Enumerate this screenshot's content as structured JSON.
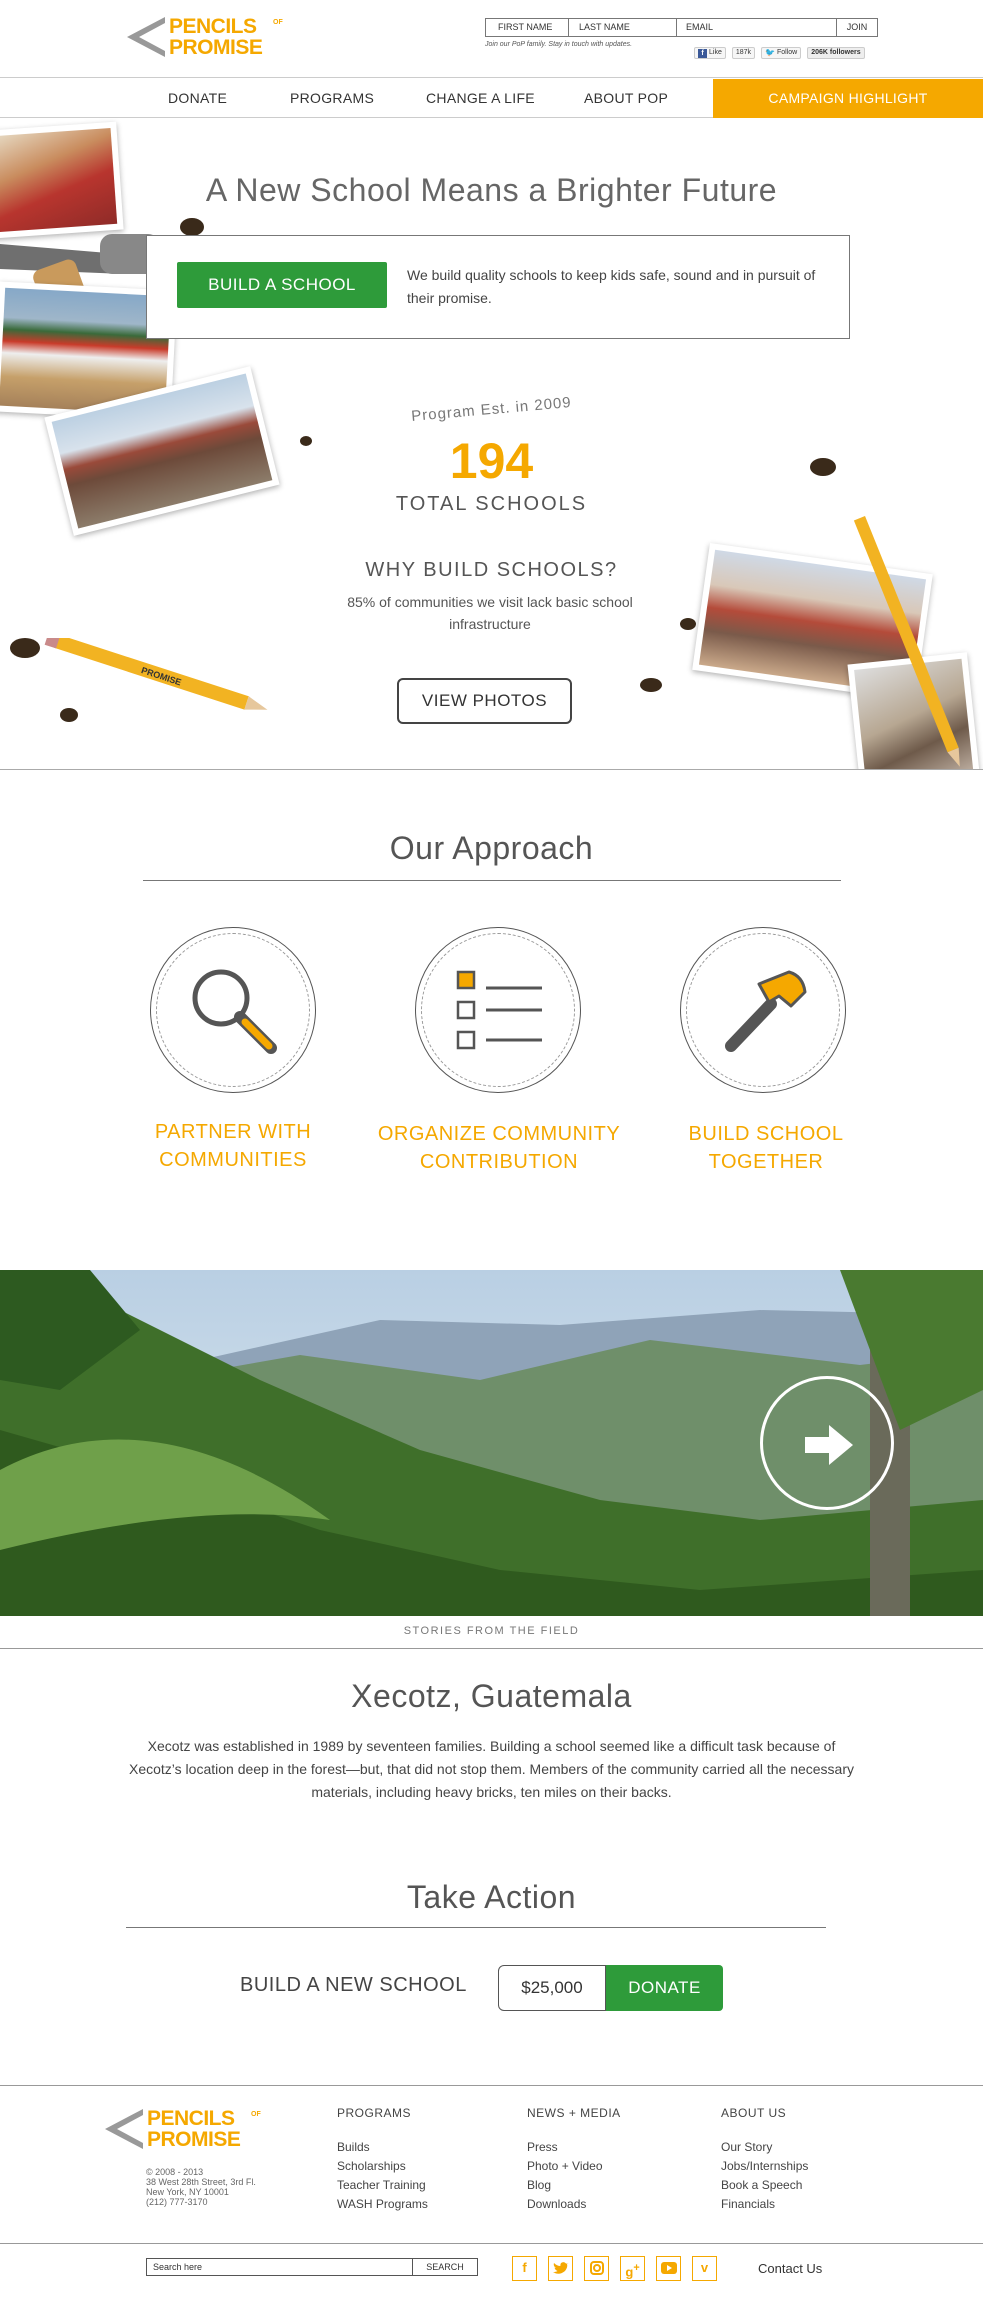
{
  "brand": {
    "name_line1": "PENCILS",
    "name_line2": "PROMISE",
    "of": "OF",
    "accent": "#f5a800",
    "green": "#2e9b3a"
  },
  "signup": {
    "first_name": "FIRST NAME",
    "last_name": "LAST NAME",
    "email": "EMAIL",
    "join": "JOIN",
    "note": "Join our PoP family. Stay in touch with updates."
  },
  "social_header": {
    "like": "Like",
    "like_count": "187k",
    "follow": "Follow",
    "followers": "206K followers"
  },
  "nav": {
    "items": [
      "DONATE",
      "PROGRAMS",
      "CHANGE A LIFE",
      "ABOUT POP"
    ],
    "cta": "CAMPAIGN HIGHLIGHT"
  },
  "hero": {
    "title": "A New School Means a Brighter Future",
    "button": "BUILD A SCHOOL",
    "description": "We build quality schools to keep kids safe, sound and in pursuit of their promise.",
    "est": "Program Est. in 2009",
    "count": "194",
    "count_label": "TOTAL SCHOOLS",
    "why_title": "WHY BUILD SCHOOLS?",
    "why_desc": "85% of communities we visit lack basic school infrastructure",
    "photos_button": "VIEW PHOTOS",
    "pencil_text": "PROMISE"
  },
  "approach": {
    "title": "Our Approach",
    "steps": [
      {
        "line1": "PARTNER WITH",
        "line2": "COMMUNITIES",
        "icon": "magnifier-icon"
      },
      {
        "line1": "ORGANIZE COMMUNITY",
        "line2": "CONTRIBUTION",
        "icon": "checklist-icon"
      },
      {
        "line1": "BUILD SCHOOL",
        "line2": "TOGETHER",
        "icon": "hammer-icon"
      }
    ]
  },
  "story": {
    "caption": "STORIES FROM THE FIELD",
    "title": "Xecotz, Guatemala",
    "text": "Xecotz was established in 1989 by seventeen families. Building a school seemed like a difficult task because of Xecotz’s location deep in the forest—but, that did not stop them. Members of the community carried all the necessary materials, including heavy bricks, ten miles on their backs."
  },
  "action": {
    "title": "Take Action",
    "label": "BUILD A NEW SCHOOL",
    "amount": "$25,000",
    "button": "DONATE"
  },
  "footer": {
    "address": [
      "© 2008 - 2013",
      "38 West 28th Street, 3rd Fl.",
      "New York, NY 10001",
      "(212) 777-3170"
    ],
    "columns": [
      {
        "heading": "PROGRAMS",
        "items": [
          "Builds",
          "Scholarships",
          "Teacher Training",
          "WASH Programs"
        ]
      },
      {
        "heading": "NEWS + MEDIA",
        "items": [
          "Press",
          "Photo + Video",
          "Blog",
          "Downloads"
        ]
      },
      {
        "heading": "ABOUT US",
        "items": [
          "Our Story",
          "Jobs/Internships",
          "Book a Speech",
          "Financials"
        ]
      }
    ],
    "search_placeholder": "Search here",
    "search_button": "SEARCH",
    "socials": [
      "f",
      "t",
      "ig",
      "g+",
      "yt",
      "v"
    ],
    "contact": "Contact Us"
  }
}
